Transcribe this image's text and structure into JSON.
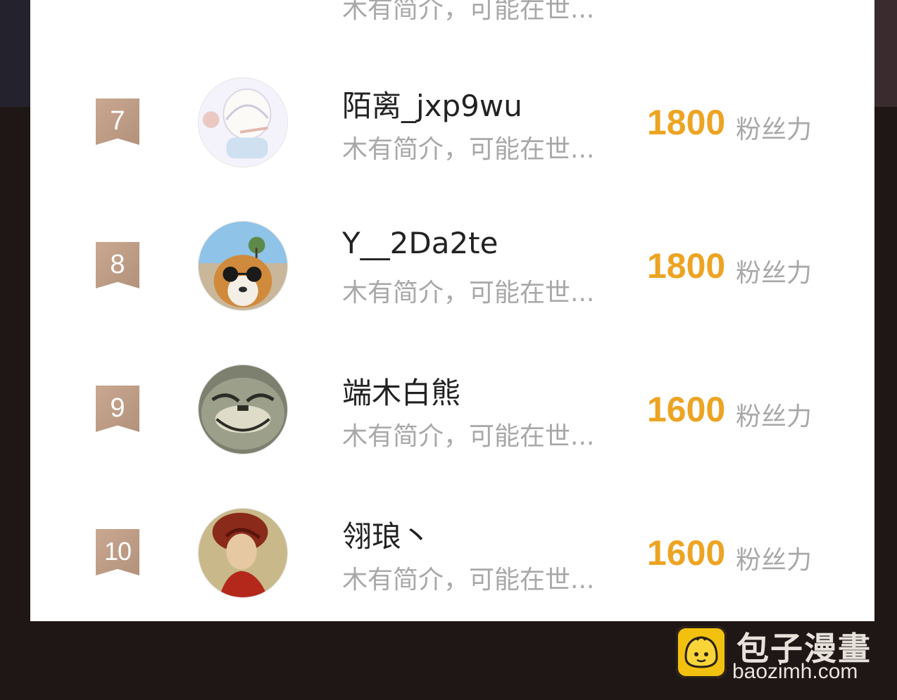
{
  "rows": [
    {
      "rank": "7",
      "name": "陌离_jxp9wu",
      "bio": "木有简介，可能在世...",
      "score": "1800",
      "unit": "粉丝力"
    },
    {
      "rank": "8",
      "name": "Y__2Da2te",
      "bio": "木有简介，可能在世...",
      "score": "1800",
      "unit": "粉丝力"
    },
    {
      "rank": "9",
      "name": "端木白熊",
      "bio": "木有简介，可能在世...",
      "score": "1600",
      "unit": "粉丝力"
    },
    {
      "rank": "10",
      "name": "翎琅丶",
      "bio": "木有简介，可能在世...",
      "score": "1600",
      "unit": "粉丝力"
    }
  ],
  "partial_row": {
    "bio": "木有简介，可能在世..."
  },
  "watermark": {
    "cn": "包子漫畫",
    "en": "baozimh.com"
  },
  "colors": {
    "score": "#eda423",
    "badge": "#c2a08a",
    "muted": "#a8a8a8",
    "panel": "#ffffff"
  }
}
